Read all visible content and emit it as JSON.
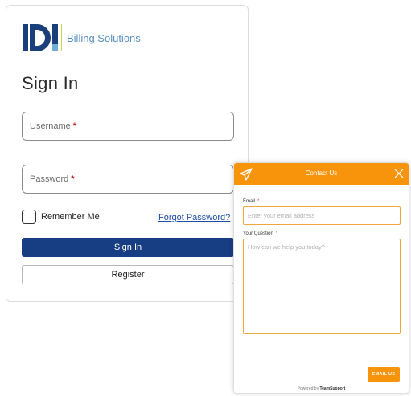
{
  "brand": {
    "logo_text": "IDI",
    "product": "Billing Solutions"
  },
  "signin": {
    "title": "Sign In",
    "username_placeholder": "Username",
    "password_placeholder": "Password",
    "required_mark": "*",
    "remember_label": "Remember Me",
    "forgot_label": "Forgot Password?",
    "signin_button": "Sign In",
    "register_button": "Register"
  },
  "contact_widget": {
    "title": "Contact Us",
    "email_label": "Email",
    "email_placeholder": "Enter your email address",
    "question_label": "Your Question",
    "question_placeholder": "How can we help you today?",
    "required_mark": "*",
    "send_button": "EMAIL US",
    "powered_prefix": "Powered by",
    "powered_brand": "TeamSupport",
    "icons": [
      "paper-plane-icon",
      "minimize-icon",
      "close-icon"
    ]
  },
  "colors": {
    "primary_button": "#173d83",
    "widget_accent": "#f7940b",
    "required": "#c0252b",
    "link": "#1c4ea8"
  }
}
